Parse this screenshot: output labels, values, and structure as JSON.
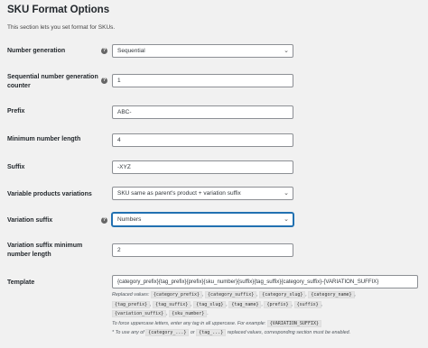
{
  "section": {
    "title": "SKU Format Options",
    "description": "This section lets you set format for SKUs."
  },
  "fields": {
    "number_generation": {
      "label": "Number generation",
      "value": "Sequential"
    },
    "seq_counter": {
      "label_line1": "Sequential number generation",
      "label_line2": "counter",
      "value": "1"
    },
    "prefix": {
      "label": "Prefix",
      "value": "ABC-"
    },
    "min_length": {
      "label": "Minimum number length",
      "value": "4"
    },
    "suffix": {
      "label": "Suffix",
      "value": "-XYZ"
    },
    "variable_variations": {
      "label": "Variable products variations",
      "value": "SKU same as parent's product + variation suffix"
    },
    "variation_suffix": {
      "label": "Variation suffix",
      "value": "Numbers"
    },
    "variation_min_length": {
      "label_line1": "Variation suffix minimum",
      "label_line2": "number length",
      "value": "2"
    },
    "template": {
      "label": "Template",
      "value": "{category_prefix}{tag_prefix}{prefix}{sku_number}{suffix}{tag_suffix}{category_suffix}-{VARIATION_SUFFIX}"
    }
  },
  "template_notes": {
    "replaced_values_label": "Replaced values:",
    "tags_line1": [
      "{category_prefix}",
      "{category_suffix}",
      "{category_slug}",
      "{category_name}"
    ],
    "tags_line2": [
      "{tag_prefix}",
      "{tag_suffix}",
      "{tag_slug}",
      "{tag_name}",
      "{prefix}",
      "{suffix}"
    ],
    "tags_line3": [
      "{variation_suffix}",
      "{sku_number}"
    ],
    "uppercase_note": "To force uppercase letters, enter any tag in all uppercase. For example:",
    "uppercase_example": "{VARIATION_SUFFIX}",
    "any_of_prefix": "* To use any of",
    "any_of_tag1": "{category_...}",
    "any_of_or": "or",
    "any_of_tag2": "{tag_...}",
    "any_of_suffix": "replaced values, corresponding section must be enabled."
  },
  "icons": {
    "help": "help-icon",
    "dropdown": "chevron-down-icon"
  }
}
